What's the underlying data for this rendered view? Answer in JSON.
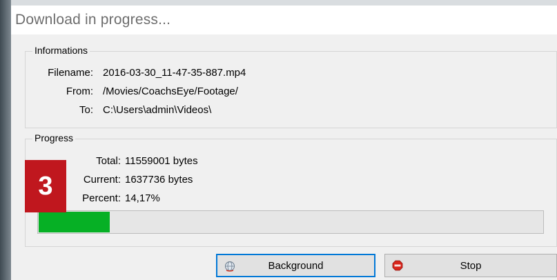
{
  "window": {
    "title": "Download in progress..."
  },
  "informations": {
    "legend": "Informations",
    "rows": [
      {
        "label": "Filename:",
        "value": "2016-03-30_11-47-35-887.mp4"
      },
      {
        "label": "From:",
        "value": "/Movies/CoachsEye/Footage/"
      },
      {
        "label": "To:",
        "value": "C:\\Users\\admin\\Videos\\"
      }
    ]
  },
  "progress": {
    "legend": "Progress",
    "rows": [
      {
        "label": "Total:",
        "value": "11559001 bytes"
      },
      {
        "label": "Current:",
        "value": "1637736 bytes"
      },
      {
        "label": "Percent:",
        "value": "14,17%"
      }
    ],
    "fraction": 0.1417,
    "fill_color": "#06b025"
  },
  "badge": {
    "text": "3",
    "color": "#c0171e"
  },
  "buttons": {
    "background": {
      "label": "Background",
      "icon": "globe-icon"
    },
    "stop": {
      "label": "Stop",
      "icon": "stop-sign-icon"
    }
  }
}
